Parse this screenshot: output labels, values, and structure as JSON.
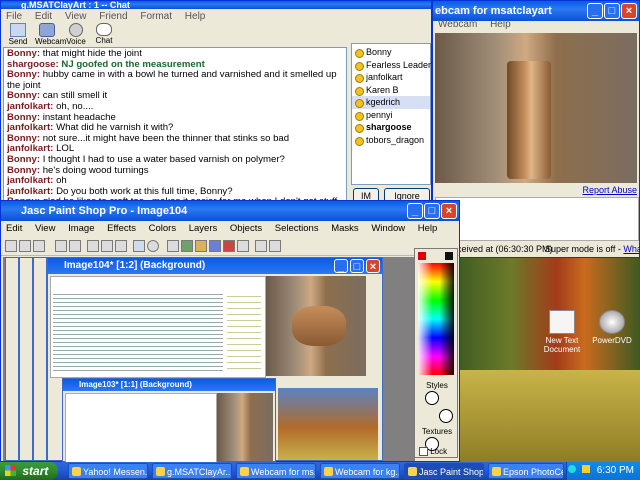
{
  "chat_window": {
    "title": "g.MSATClayArt : 1 -- Chat",
    "menu": [
      "File",
      "Edit",
      "View",
      "Friend",
      "Format",
      "Help"
    ],
    "toolbar": [
      "Send File",
      "Webcam",
      "Voice",
      "Chat"
    ],
    "messages": [
      {
        "who": "Bonny:",
        "text": "that might hide the joint"
      },
      {
        "who": "shargoose:",
        "text": "NJ goofed on the measurement",
        "highlight": true
      },
      {
        "who": "Bonny:",
        "text": "hubby came in with a bowl he turned and varnished and it smelled up the joint"
      },
      {
        "who": "Bonny:",
        "text": "can still smell it"
      },
      {
        "who": "janfolkart:",
        "text": "oh, no...."
      },
      {
        "who": "Bonny:",
        "text": "instant headache"
      },
      {
        "who": "janfolkart:",
        "text": "What did he varnish it with?"
      },
      {
        "who": "Bonny:",
        "text": "not sure...it might have been the thinner that stinks so bad"
      },
      {
        "who": "janfolkart:",
        "text": "LOL"
      },
      {
        "who": "Bonny:",
        "text": "I thought I had to use a water based varnish on polymer?"
      },
      {
        "who": "Bonny:",
        "text": "he's doing wood turnings"
      },
      {
        "who": "janfolkart:",
        "text": "oh"
      },
      {
        "who": "janfolkart:",
        "text": "Do you both work at this full time, Bonny?"
      },
      {
        "who": "Bonny:",
        "text": "glad he likes to craft too...makes it easier for me when I don't get stuff done around the house lol"
      }
    ],
    "buddies": [
      "Bonny",
      "Fearless Leader",
      "janfolkart",
      "Karen B",
      "kgedrich",
      "pennyi",
      "shargoose",
      "tobors_dragon"
    ],
    "buddy_selected": "kgedrich",
    "buddy_bold": "shargoose",
    "im_button": "IM",
    "ignore_button": "Ignore User"
  },
  "webcam_window": {
    "title": "ebcam for msatclayart",
    "menu": [
      "Webcam",
      "Help"
    ],
    "report_link": "Report Abuse",
    "received_text": "ceived at (06:30:30 PM)",
    "super_mode": "Super mode is off -",
    "whats_this": "What's this?"
  },
  "psp_window": {
    "title": "Jasc Paint Shop Pro - Image104",
    "menu": [
      "Edit",
      "View",
      "Image",
      "Effects",
      "Colors",
      "Layers",
      "Objects",
      "Selections",
      "Masks",
      "Window",
      "Help"
    ],
    "doc_title": "Image104* [1:2] (Background)",
    "doc2_title": "Image103* [1:1] (Background)",
    "palette": {
      "styles": "Styles",
      "textures": "Textures",
      "lock": "Lock"
    }
  },
  "desktop_icons": [
    {
      "label": "New Text Document"
    },
    {
      "label": "PowerDVD"
    }
  ],
  "taskbar": {
    "start": "start",
    "tasks": [
      "Yahoo! Messen...",
      "g.MSATClayAr...",
      "Webcam for ms...",
      "Webcam for kg...",
      "Jasc Paint Shop...",
      "Epson PhotoCe..."
    ],
    "active_index": 4,
    "clock": "6:30 PM"
  }
}
